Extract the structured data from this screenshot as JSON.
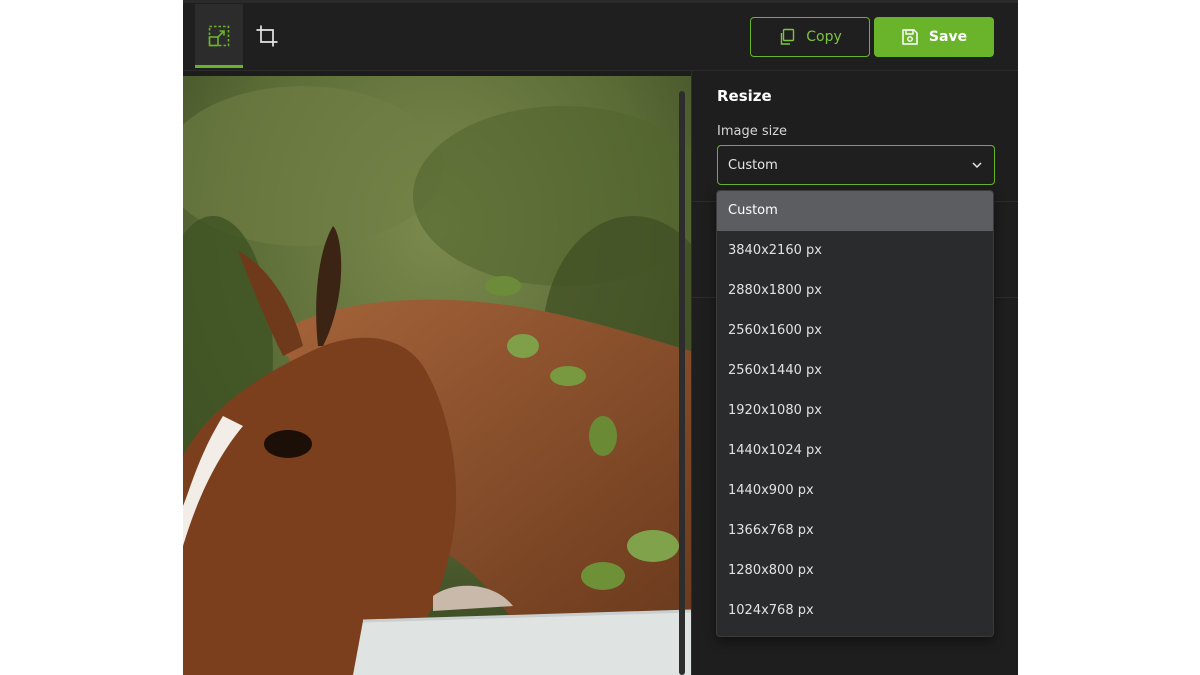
{
  "toolbar": {
    "tools": [
      {
        "icon": "resize-icon",
        "active": true
      },
      {
        "icon": "crop-icon",
        "active": false
      }
    ],
    "copy_label": "Copy",
    "save_label": "Save"
  },
  "panel": {
    "title": "Resize",
    "image_size_label": "Image size",
    "selected_value": "Custom"
  },
  "dropdown": {
    "options": [
      "Custom",
      "3840x2160 px",
      "2880x1800 px",
      "2560x1600 px",
      "2560x1440 px",
      "1920x1080 px",
      "1440x1024 px",
      "1440x900 px",
      "1366x768 px",
      "1280x800 px",
      "1024x768 px"
    ],
    "selected_index": 0
  },
  "colors": {
    "accent": "#6ab42b",
    "background": "#1c1c1c",
    "dropdown_bg": "#2a2b2d",
    "selected_bg": "#5c5d60"
  }
}
